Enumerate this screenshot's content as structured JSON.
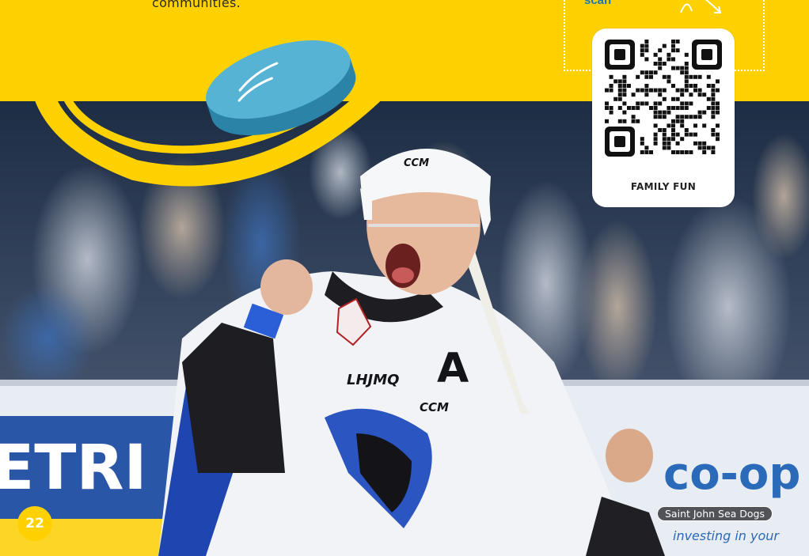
{
  "page": {
    "intro_text_fragment": "communities.",
    "scan_label_fragment": "scan",
    "qr_card": {
      "label": "FAMILY FUN"
    },
    "page_number": "22",
    "photo_credit": "Saint John Sea Dogs",
    "photo": {
      "helmet_brand": "CCM",
      "jersey_letter": "A",
      "jersey_brand": "CCM",
      "league_logo": "LHJMQ",
      "dasher_ad_left": "ETRI",
      "dasher_ad_right": "co-op",
      "dasher_ad_right_sub": "investing in your"
    }
  },
  "colors": {
    "brand_yellow": "#ffd100",
    "scan_blue": "#1b75bb",
    "puck": "#3e9fc1"
  },
  "icons": [
    "hockey-puck-illustration",
    "qr-code",
    "arrow-doodle"
  ]
}
